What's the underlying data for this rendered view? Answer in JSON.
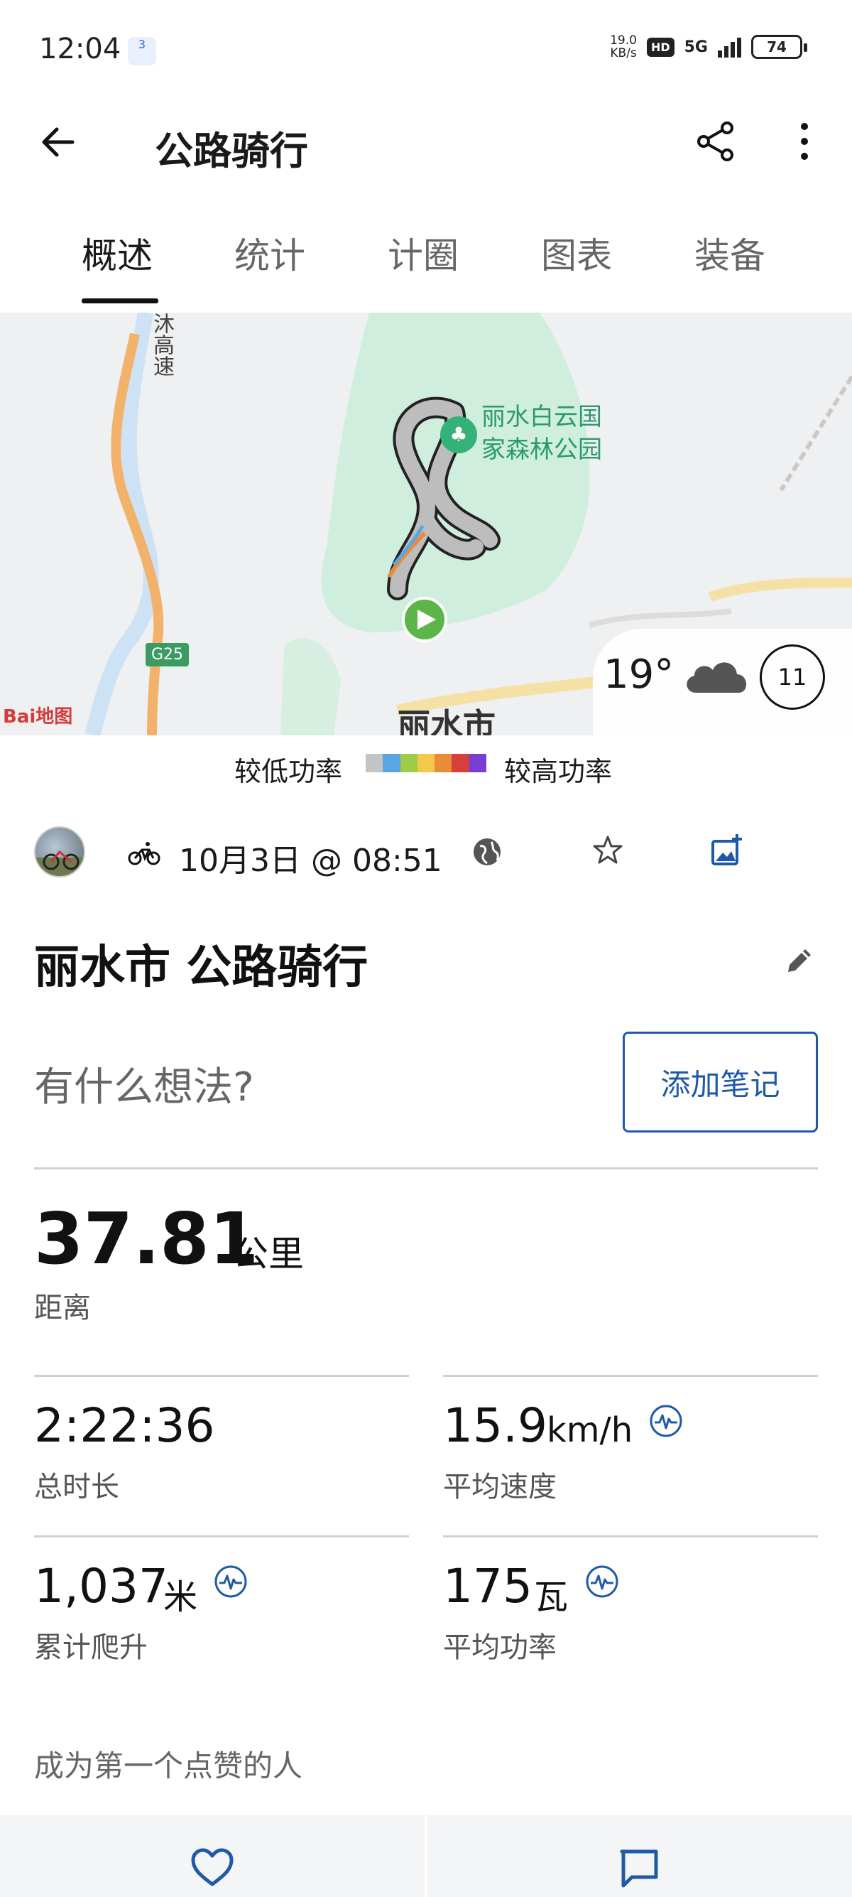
{
  "status_bar": {
    "time": "12:04",
    "notification_badge": "3",
    "net_speed_value": "19.0",
    "net_speed_unit": "KB/s",
    "hd_label": "HD",
    "signal_label": "5G",
    "battery": "74"
  },
  "header": {
    "title": "公路骑行"
  },
  "tabs": [
    {
      "label": "概述",
      "active": true
    },
    {
      "label": "统计",
      "active": false
    },
    {
      "label": "计圈",
      "active": false
    },
    {
      "label": "图表",
      "active": false
    },
    {
      "label": "装备",
      "active": false
    }
  ],
  "map": {
    "poi_line1": "丽水白云国",
    "poi_line2": "家森林公园",
    "road_badge": "G25",
    "highway_label": "沐高速",
    "city_label": "丽水市",
    "attribution": "Bai地图",
    "weather": {
      "temperature": "19°",
      "condition_icon": "cloud-icon",
      "wind_speed": "11"
    }
  },
  "legend": {
    "low_label": "较低功率",
    "high_label": "较高功率",
    "colors": [
      "#c4c4c4",
      "#5aa6e0",
      "#9ccc4a",
      "#f2c94c",
      "#ea8b3a",
      "#d6403a",
      "#7a3dd1"
    ]
  },
  "activity": {
    "sport_icon": "bike-icon",
    "date_time": "10月3日 @ 08:51",
    "title": "丽水市 公路骑行",
    "note_prompt": "有什么想法?",
    "add_note_button": "添加笔记"
  },
  "stats": {
    "distance": {
      "value": "37.81",
      "unit": "公里",
      "label": "距离"
    },
    "duration": {
      "value": "2:22:36",
      "label": "总时长"
    },
    "avg_speed": {
      "value": "15.9",
      "unit": "km/h",
      "label": "平均速度"
    },
    "elevation": {
      "value": "1,037",
      "unit": "米",
      "label": "累计爬升"
    },
    "avg_power": {
      "value": "175",
      "unit": "瓦",
      "label": "平均功率"
    }
  },
  "social": {
    "likes_text": "成为第一个点赞的人"
  },
  "colors": {
    "accent": "#1f5aa8",
    "park_green": "#cfeedd",
    "start_marker": "#5bb548"
  }
}
